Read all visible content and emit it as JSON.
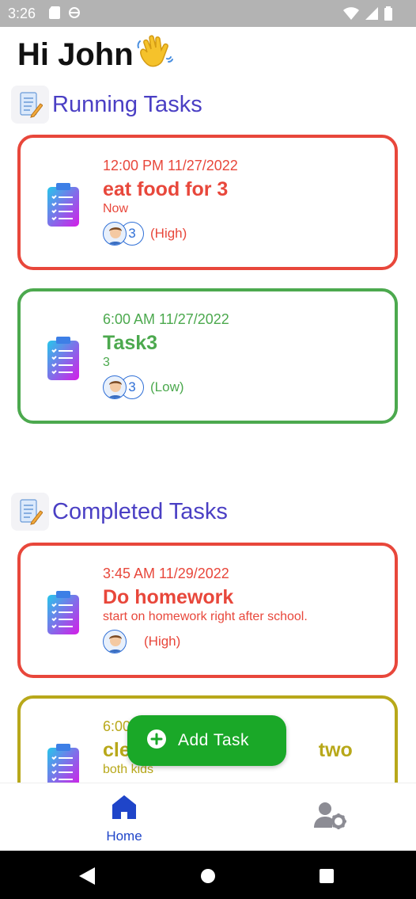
{
  "status_bar": {
    "time": "3:26"
  },
  "greeting": "Hi John",
  "sections": {
    "running": {
      "title": "Running Tasks"
    },
    "completed": {
      "title": "Completed Tasks"
    }
  },
  "running_tasks": [
    {
      "time": "12:00 PM 11/27/2022",
      "title": "eat food for 3",
      "description": "Now",
      "count": "3",
      "priority": "(High)"
    },
    {
      "time": "6:00 AM 11/27/2022",
      "title": "Task3",
      "description": "3",
      "count": "3",
      "priority": "(Low)"
    }
  ],
  "completed_tasks": [
    {
      "time": "3:45 AM 11/29/2022",
      "title": "Do homework",
      "description": "start on homework right after school.",
      "priority": "(High)"
    },
    {
      "time": "6:00",
      "title": "cle",
      "title_end": "two",
      "description": "both kids"
    }
  ],
  "fab": {
    "label": "Add Task"
  },
  "bottom_nav": {
    "home_label": "Home"
  },
  "colors": {
    "high": "#e8473b",
    "low": "#4ca94e",
    "medium": "#b8a81a",
    "accent": "#4a3fc4",
    "fab": "#1aa828",
    "nav_active": "#1f45c9"
  }
}
